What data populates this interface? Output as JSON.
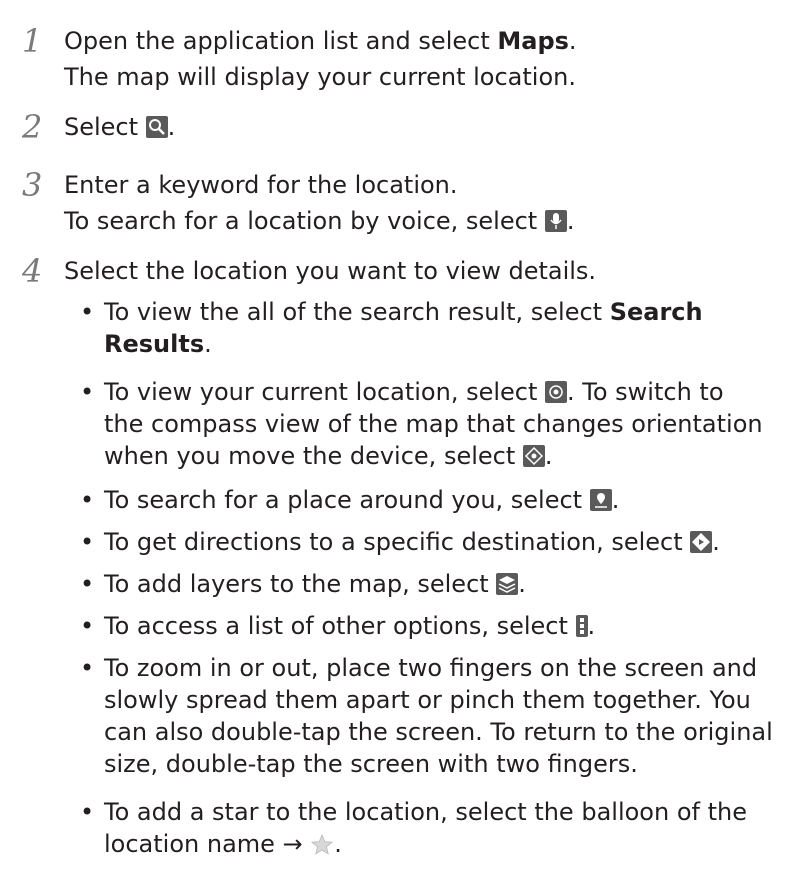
{
  "steps": [
    {
      "num": "1",
      "line1_pre": "Open the application list and select ",
      "line1_bold": "Maps",
      "line1_post": ".",
      "line2": "The map will display your current location."
    },
    {
      "num": "2",
      "pre": "Select ",
      "icon": "search-icon",
      "post": "."
    },
    {
      "num": "3",
      "line1": "Enter a keyword for the location.",
      "line2_pre": "To search for a location by voice, select ",
      "icon": "microphone-icon",
      "line2_post": "."
    },
    {
      "num": "4",
      "line1": "Select the location you want to view details."
    }
  ],
  "bullets": {
    "dot": "•",
    "b1": {
      "l1_pre": "To view the all of the search result, select ",
      "l1_bold": "Search",
      "l2_bold": "Results",
      "l2_post": "."
    },
    "b2": {
      "l1_pre": "To view your current location, select ",
      "l1_mid": ". To switch to",
      "l2": "the compass view of the map that changes orientation",
      "l3_pre": "when you move the device, select ",
      "l3_post": "."
    },
    "b3": {
      "pre": "To search for a place around you, select ",
      "post": "."
    },
    "b4": {
      "pre": "To get directions to a specific destination, select ",
      "post": "."
    },
    "b5": {
      "pre": "To add layers to the map, select ",
      "post": "."
    },
    "b6": {
      "pre": "To access a list of other options, select ",
      "post": "."
    },
    "b7": {
      "l1": "To zoom in or out, place two fingers on the screen and",
      "l2": "slowly spread them apart or pinch them together. You",
      "l3": "can also double-tap the screen. To return to the original",
      "l4": "size, double-tap the screen with two fingers."
    },
    "b8": {
      "l1": "To add a star to the location, select the balloon of the",
      "l2": "location name →",
      "l2_post": "."
    }
  },
  "icons": [
    "search-icon",
    "microphone-icon",
    "my-location-icon",
    "compass-icon",
    "places-icon",
    "directions-icon",
    "layers-icon",
    "menu-icon",
    "star-icon"
  ]
}
